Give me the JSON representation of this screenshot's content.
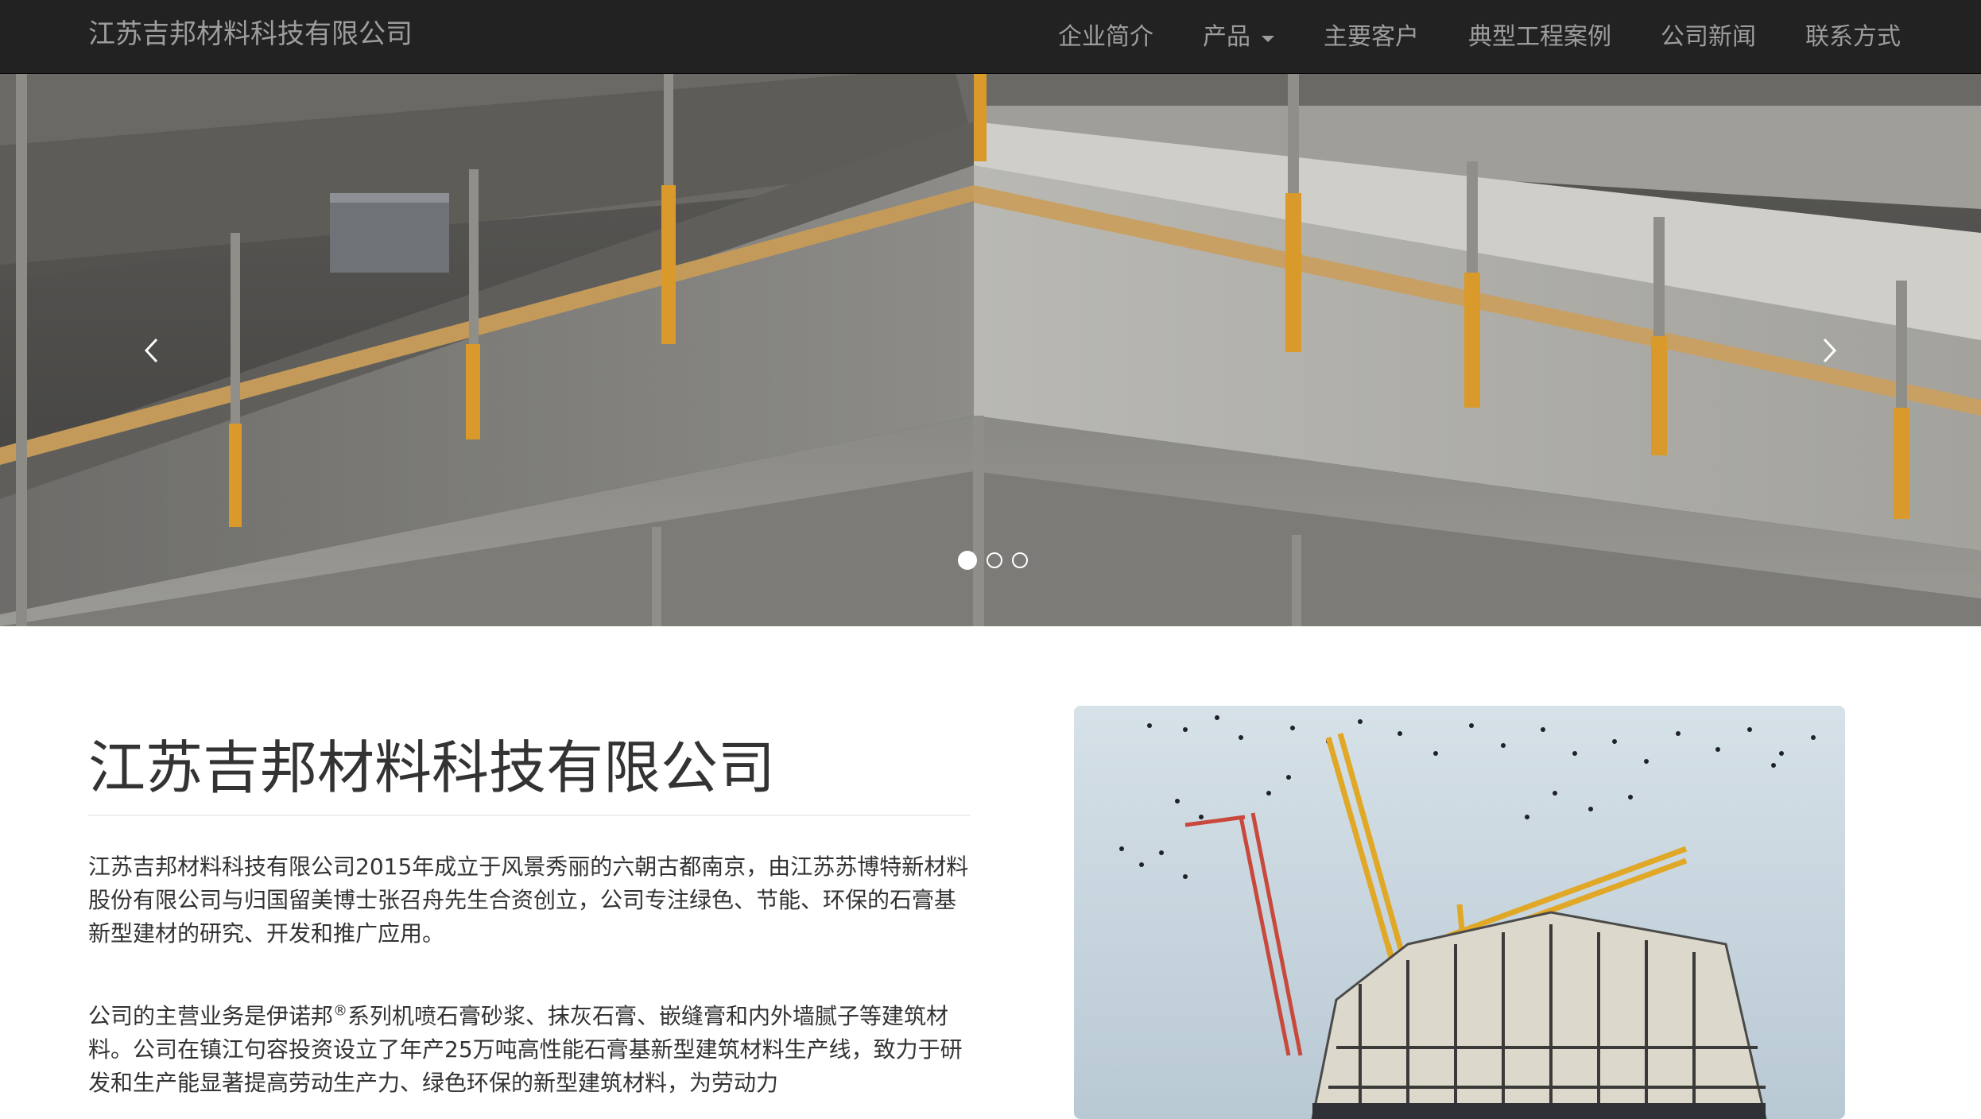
{
  "navbar": {
    "brand": "江苏吉邦材料科技有限公司",
    "items": [
      {
        "label": "企业简介"
      },
      {
        "label": "产品",
        "dropdown": true
      },
      {
        "label": "主要客户"
      },
      {
        "label": "典型工程案例"
      },
      {
        "label": "公司新闻"
      },
      {
        "label": "联系方式"
      }
    ],
    "background_color": "#222222",
    "text_color": "#9d9d9d"
  },
  "carousel": {
    "image": "concrete-building-under-construction",
    "prev_icon": "chevron-left-icon",
    "next_icon": "chevron-right-icon",
    "slide_count": 3,
    "active_slide": 1
  },
  "main": {
    "title": "江苏吉邦材料科技有限公司",
    "paragraph1": "江苏吉邦材料科技有限公司2015年成立于风景秀丽的六朝古都南京，由江苏苏博特新材料股份有限公司与归国留美博士张召舟先生合资创立，公司专注绿色、节能、环保的石膏基新型建材的研究、开发和推广应用。",
    "paragraph2_before": "公司的主营业务是伊诺邦",
    "paragraph2_sup": "®",
    "paragraph2_after": "系列机喷石膏砂浆、抹灰石膏、嵌缝膏和内外墙腻子等建筑材料。公司在镇江句容投资设立了年产25万吨高性能石膏基新型建筑材料生产线，致力于研发和生产能显著提高劳动生产力、绿色环保的新型建筑材料，为劳动力",
    "side_image": "construction-cranes-with-birds"
  }
}
